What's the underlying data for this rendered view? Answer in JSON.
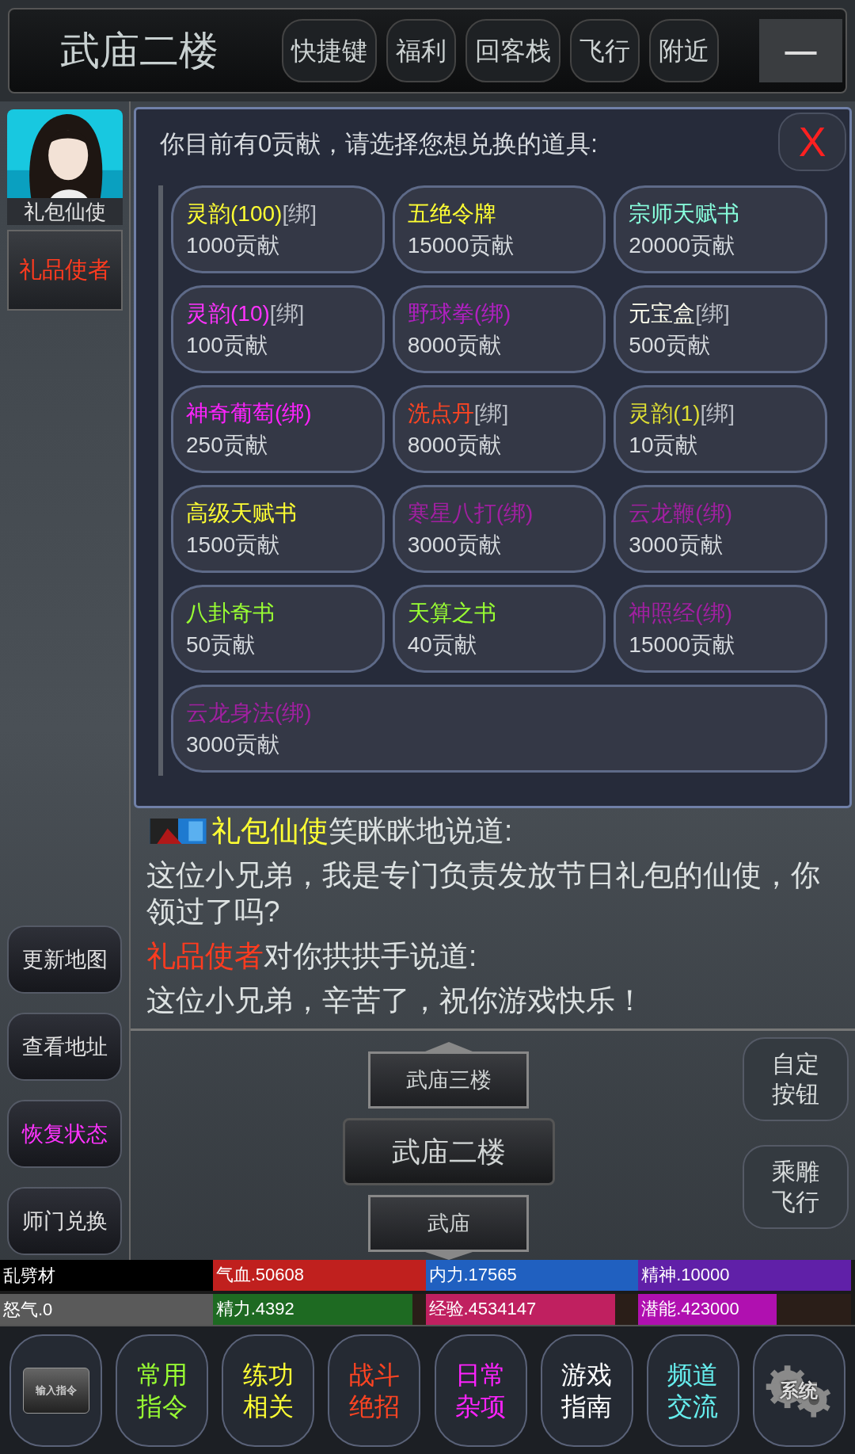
{
  "top_bar": {
    "title": "武庙二楼",
    "buttons": [
      "快捷键",
      "福利",
      "回客栈",
      "飞行",
      "附近"
    ],
    "minimize": "—"
  },
  "npc_panel": {
    "avatar_label": "礼包仙使",
    "npc_button": {
      "label": "礼品使者",
      "color": "#ff3b1f"
    }
  },
  "side_buttons": [
    {
      "label": "更新地图",
      "highlighted": false
    },
    {
      "label": "查看地址",
      "highlighted": false
    },
    {
      "label": "恢复状态",
      "highlighted": true
    },
    {
      "label": "师门兑换",
      "highlighted": false
    }
  ],
  "exchange_dialog": {
    "prompt": "你目前有0贡献，请选择您想兑换的道具:",
    "close": "X",
    "items": [
      {
        "name": "灵韵(100)",
        "suffix": "[绑]",
        "color": "#ffff33",
        "cost": "1000贡献"
      },
      {
        "name": "五绝令牌",
        "color": "#ffff33",
        "cost": "15000贡献"
      },
      {
        "name": "宗师天赋书",
        "color": "#88ffdd",
        "cost": "20000贡献"
      },
      {
        "name": "灵韵(10)",
        "suffix": "[绑]",
        "color": "#ff33ff",
        "cost": "100贡献"
      },
      {
        "name": "野球拳(绑)",
        "color": "#b020c0",
        "cost": "8000贡献"
      },
      {
        "name": "元宝盒",
        "suffix": "[绑]",
        "color": "#ffffee",
        "cost": "500贡献"
      },
      {
        "name": "神奇葡萄(绑)",
        "color": "#ff22ff",
        "cost": "250贡献"
      },
      {
        "name": "洗点丹",
        "suffix": "[绑]",
        "color": "#ff4422",
        "cost": "8000贡献"
      },
      {
        "name": "灵韵(1)",
        "suffix": "[绑]",
        "color": "#dddd33",
        "cost": "10贡献"
      },
      {
        "name": "高级天赋书",
        "color": "#ffff33",
        "cost": "1500贡献"
      },
      {
        "name": "寒星八打(绑)",
        "color": "#a020a0",
        "cost": "3000贡献"
      },
      {
        "name": "云龙鞭(绑)",
        "color": "#a020a0",
        "cost": "3000贡献"
      },
      {
        "name": "八卦奇书",
        "color": "#99ff33",
        "cost": "50贡献"
      },
      {
        "name": "天算之书",
        "color": "#99ff33",
        "cost": "40贡献"
      },
      {
        "name": "神照经(绑)",
        "color": "#a020a0",
        "cost": "15000贡献"
      },
      {
        "name": "云龙身法(绑)",
        "color": "#a020a0",
        "cost": "3000贡献"
      }
    ]
  },
  "chat": [
    {
      "kind": "avatar",
      "speaker": "礼包仙使",
      "color": "#ffff33",
      "text": "笑眯眯地说道:"
    },
    {
      "kind": "plain",
      "text": "这位小兄弟，我是专门负责发放节日礼包的仙使，你领过了吗?"
    },
    {
      "kind": "plain",
      "speaker": "礼品使者",
      "color": "#ff3b1f",
      "text": "对你拱拱手说道:"
    },
    {
      "kind": "plain",
      "text": "这位小兄弟，辛苦了，祝你游戏快乐！"
    }
  ],
  "map": {
    "north": "武庙三楼",
    "current": "武庙二楼",
    "south": "武庙"
  },
  "map_buttons": [
    "自定按钮",
    "乘雕飞行"
  ],
  "stats": [
    {
      "kind": "name",
      "label": "乱劈材",
      "color": "#000000"
    },
    {
      "kind": "bar",
      "label": "气血.50608",
      "color": "#c0201e",
      "level": 1
    },
    {
      "kind": "bar",
      "label": "内力.17565",
      "color": "#2060c0",
      "level": 1
    },
    {
      "kind": "bar",
      "label": "精神.10000",
      "color": "#6020a8",
      "level": 1
    },
    {
      "kind": "name",
      "label": "怒气.0",
      "color": "#5a5a5a"
    },
    {
      "kind": "bar",
      "label": "精力.4392",
      "color": "#1e6a22",
      "level": 0.94
    },
    {
      "kind": "bar",
      "label": "经验.4534147",
      "color": "#c02060",
      "level": 0.89
    },
    {
      "kind": "bar",
      "label": "潜能.423000",
      "color": "#b010b0",
      "level": 0.65
    }
  ],
  "toolbar": [
    {
      "kind": "input",
      "label": "输入指令",
      "color": "#cccccc"
    },
    {
      "kind": "text",
      "label": "常用指令",
      "color": "#99ff33"
    },
    {
      "kind": "text",
      "label": "练功相关",
      "color": "#ffff33"
    },
    {
      "kind": "text",
      "label": "战斗绝招",
      "color": "#ff4422"
    },
    {
      "kind": "text",
      "label": "日常杂项",
      "color": "#ff22ff"
    },
    {
      "kind": "text",
      "label": "游戏指南",
      "color": "#ffffff"
    },
    {
      "kind": "text",
      "label": "频道交流",
      "color": "#66eeee"
    },
    {
      "kind": "gear",
      "label": "系统",
      "color": "#dddddd"
    }
  ]
}
